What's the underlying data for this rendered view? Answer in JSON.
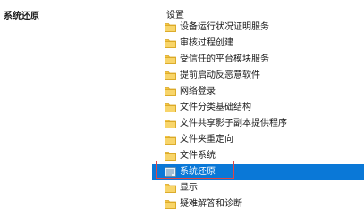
{
  "left_pane": {
    "title": "系统还原"
  },
  "right_pane": {
    "header": "设置",
    "items": [
      {
        "label": "设备运行状况证明服务",
        "icon": "folder-icon",
        "selected": false
      },
      {
        "label": "审核过程创建",
        "icon": "folder-icon",
        "selected": false
      },
      {
        "label": "受信任的平台模块服务",
        "icon": "folder-icon",
        "selected": false
      },
      {
        "label": "提前启动反恶意软件",
        "icon": "folder-icon",
        "selected": false
      },
      {
        "label": "网络登录",
        "icon": "folder-icon",
        "selected": false
      },
      {
        "label": "文件分类基础结构",
        "icon": "folder-icon",
        "selected": false
      },
      {
        "label": "文件共享影子副本提供程序",
        "icon": "folder-icon",
        "selected": false
      },
      {
        "label": "文件夹重定向",
        "icon": "folder-icon",
        "selected": false
      },
      {
        "label": "文件系统",
        "icon": "folder-icon",
        "selected": false
      },
      {
        "label": "系统还原",
        "icon": "policy-setting-icon",
        "selected": true
      },
      {
        "label": "显示",
        "icon": "folder-icon",
        "selected": false
      },
      {
        "label": "疑难解答和诊断",
        "icon": "folder-icon",
        "selected": false
      }
    ]
  },
  "colors": {
    "selection": "#0a78d7",
    "highlight_box": "#e04646",
    "folder": "#f5c542"
  }
}
